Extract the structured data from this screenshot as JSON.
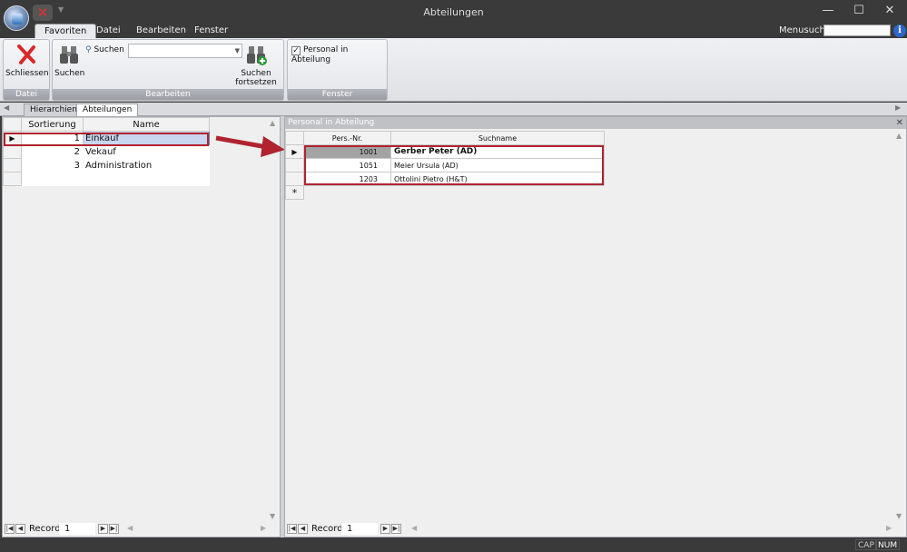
{
  "window": {
    "title": "Abteilungen"
  },
  "ribbon_tabs": [
    "Favoriten",
    "Datei",
    "Bearbeiten",
    "Fenster"
  ],
  "menusuche": {
    "label": "Menusuche",
    "value": ""
  },
  "groups": {
    "datei": {
      "label": "Datei",
      "close_label": "Schliessen"
    },
    "bearbeiten": {
      "label": "Bearbeiten",
      "suchen_label": "Suchen",
      "suchen_small_label": "Suchen",
      "combo_value": "",
      "fortsetzen_line1": "Suchen",
      "fortsetzen_line2": "fortsetzen"
    },
    "fenster": {
      "label": "Fenster",
      "checkbox_label": "Personal in Abteilung",
      "checked": true
    }
  },
  "doc_tabs": [
    "Hierarchien",
    "Abteilungen"
  ],
  "left_grid": {
    "headers": [
      "Sortierung",
      "Name"
    ],
    "rows": [
      {
        "sort": "1",
        "name": "Einkauf",
        "current": true
      },
      {
        "sort": "2",
        "name": "Vekauf"
      },
      {
        "sort": "3",
        "name": "Administration"
      }
    ],
    "nav": {
      "label": "Record",
      "value": "1"
    }
  },
  "right_panel": {
    "title": "Personal in Abteilung",
    "headers": [
      "Pers.-Nr.",
      "Suchname"
    ],
    "rows": [
      {
        "nr": "1001",
        "name": "Gerber Peter (AD)",
        "current": true
      },
      {
        "nr": "1051",
        "name": "Meier Ursula (AD)"
      },
      {
        "nr": "1203",
        "name": "Ottolini Pietro (H&T)"
      }
    ],
    "new_row_marker": "*",
    "nav": {
      "label": "Record",
      "value": "1"
    }
  },
  "statusbar": {
    "cap": "CAP",
    "num": "NUM"
  },
  "colors": {
    "highlight": "#b0232f",
    "titlebar": "#3a3a3a"
  }
}
